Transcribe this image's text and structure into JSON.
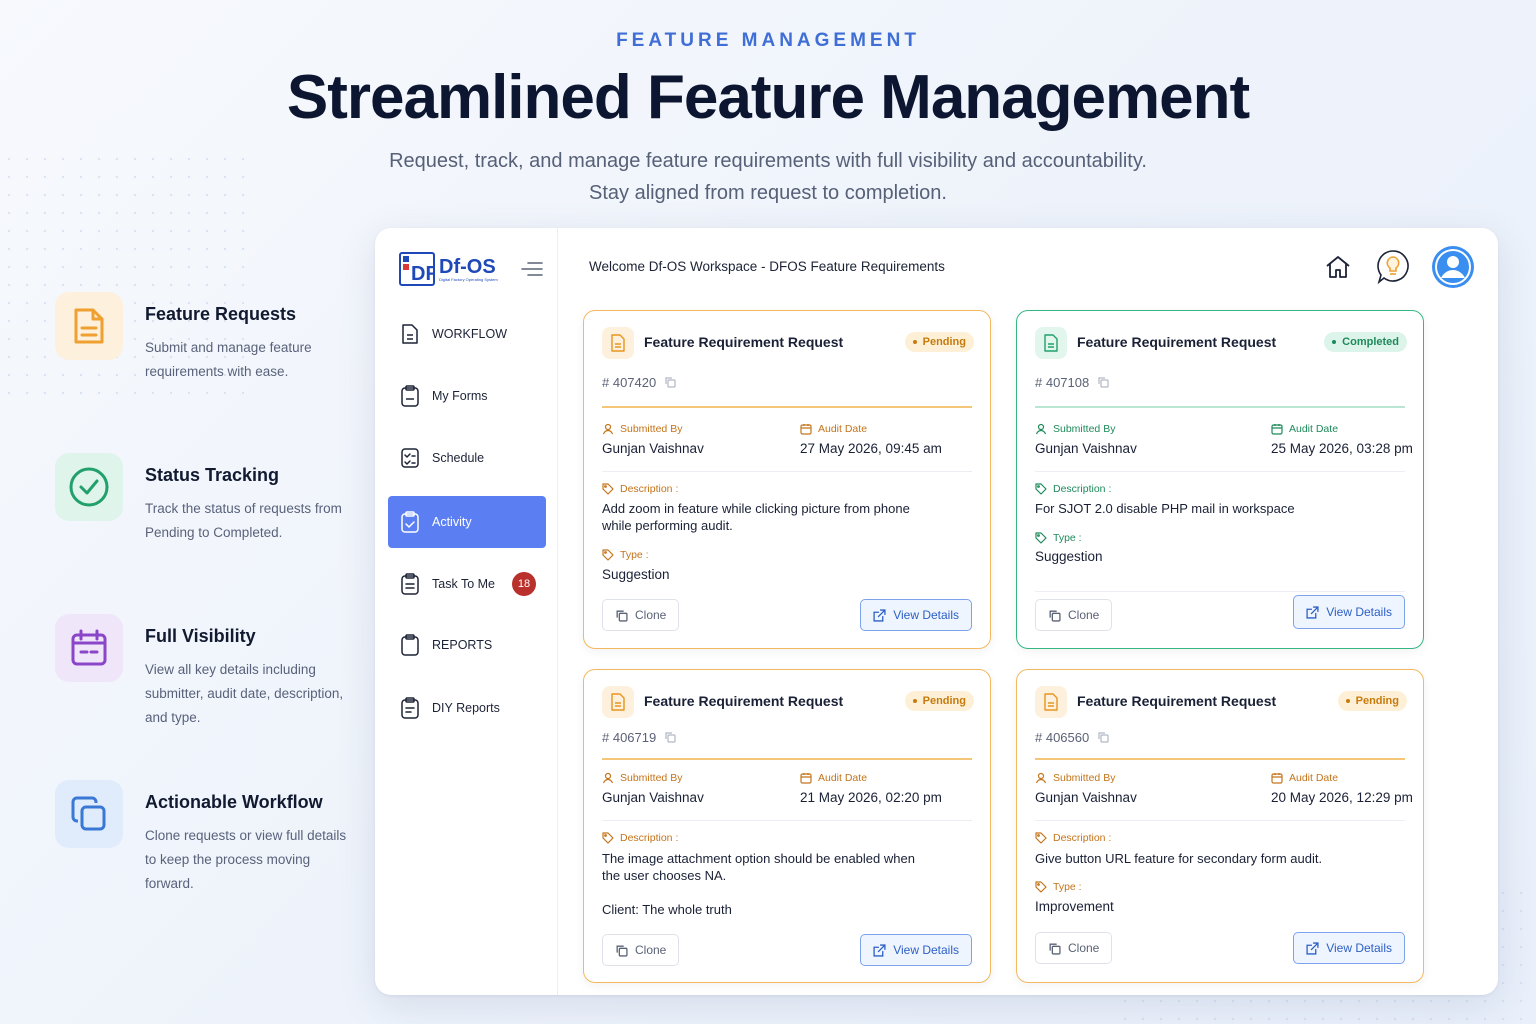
{
  "hero": {
    "eyebrow": "FEATURE MANAGEMENT",
    "title": "Streamlined Feature Management",
    "subtitle_line1": "Request, track, and manage feature requirements with full visibility and accountability.",
    "subtitle_line2": "Stay aligned from request to completion."
  },
  "features": [
    {
      "title": "Feature Requests",
      "desc": "Submit and manage feature requirements with ease.",
      "icon": "document-icon",
      "color": "#f0a030"
    },
    {
      "title": "Status Tracking",
      "desc": "Track the status of requests from Pending to Completed.",
      "icon": "check-circle-icon",
      "color": "#22a06b"
    },
    {
      "title": "Full Visibility",
      "desc": "View all key details including submitter, audit date, description, and type.",
      "icon": "calendar-icon",
      "color": "#8a46c9"
    },
    {
      "title": "Actionable Workflow",
      "desc": "Clone requests or view full details to keep the process moving forward.",
      "icon": "copy-icon",
      "color": "#3a78d6"
    }
  ],
  "app": {
    "logo_text": "Df-OS",
    "logo_small": "Digital Factory Operating System",
    "logo_mark": "DF",
    "welcome": "Welcome Df-OS Workspace - DFOS Feature Requirements",
    "nav": [
      {
        "label": "WORKFLOW",
        "icon": "document-icon"
      },
      {
        "label": "My Forms",
        "icon": "clipboard-icon"
      },
      {
        "label": "Schedule",
        "icon": "checklist-icon"
      },
      {
        "label": "Activity",
        "icon": "clipboard-check-icon",
        "active": true
      },
      {
        "label": "Task To Me",
        "icon": "clipboard-list-icon",
        "badge": "18"
      },
      {
        "label": "REPORTS",
        "icon": "clipboard-icon"
      },
      {
        "label": "DIY Reports",
        "icon": "clipboard-text-icon"
      }
    ],
    "accent": "#5b7ff3"
  },
  "labels": {
    "submitted_by": "Submitted By",
    "audit_date": "Audit Date",
    "description": "Description :",
    "type": "Type :",
    "clone": "Clone",
    "view_details": "View Details"
  },
  "cards": [
    {
      "title": "Feature Requirement Request",
      "status": "Pending",
      "id": "# 407420",
      "submitted_by": "Gunjan Vaishnav",
      "audit_date": "27 May 2026, 09:45 am",
      "description_l1": "Add zoom in feature while clicking picture from phone",
      "description_l2": "while performing audit.",
      "type": "Suggestion"
    },
    {
      "title": "Feature Requirement Request",
      "status": "Completed",
      "id": "# 407108",
      "submitted_by": "Gunjan Vaishnav",
      "audit_date": "25 May 2026, 03:28 pm",
      "description_l1": "For SJOT 2.0 disable PHP mail in workspace",
      "type": "Suggestion"
    },
    {
      "title": "Feature Requirement Request",
      "status": "Pending",
      "id": "# 406719",
      "submitted_by": "Gunjan Vaishnav",
      "audit_date": "21 May 2026, 02:20 pm",
      "description_l1": "The image attachment option should be enabled when",
      "description_l2": "the user chooses NA.",
      "description_l3": "Client: The whole truth"
    },
    {
      "title": "Feature Requirement Request",
      "status": "Pending",
      "id": "# 406560",
      "submitted_by": "Gunjan Vaishnav",
      "audit_date": "20 May 2026, 12:29 pm",
      "description_l1": "Give button URL feature for secondary form audit.",
      "type": "Improvement"
    }
  ]
}
